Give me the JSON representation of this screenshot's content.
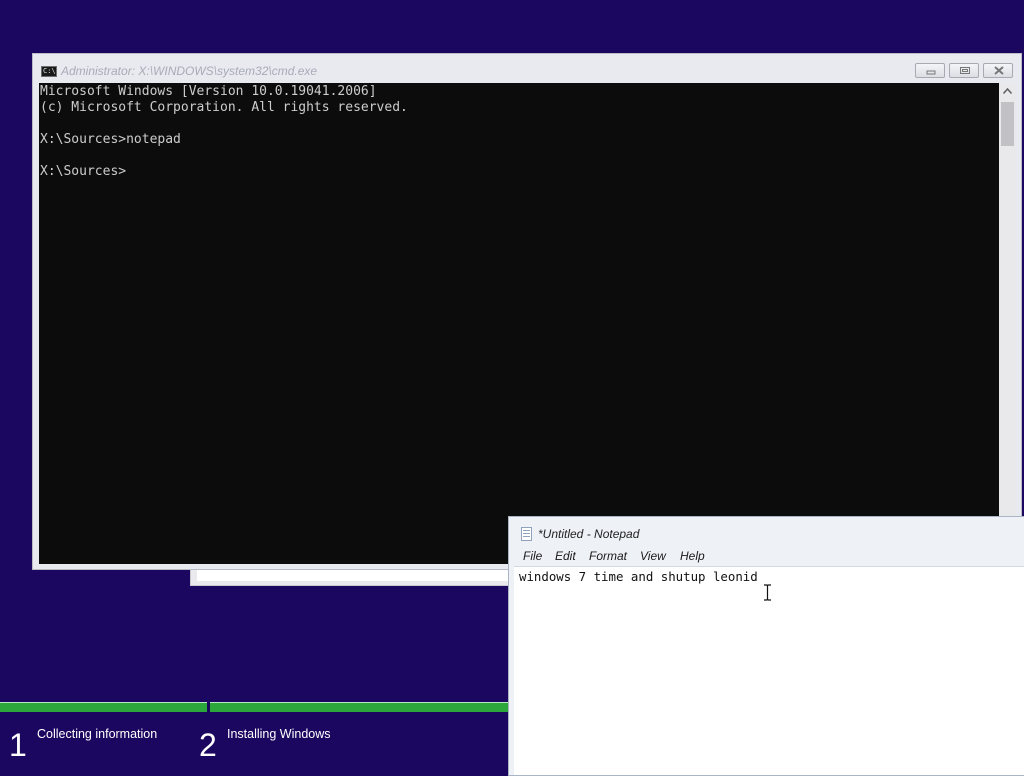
{
  "cmd_window": {
    "title": "Administrator: X:\\WINDOWS\\system32\\cmd.exe",
    "icon_text": "C:\\.",
    "console_lines": [
      "Microsoft Windows [Version 10.0.19041.2006]",
      "(c) Microsoft Corporation. All rights reserved.",
      "",
      "X:\\Sources>notepad",
      "",
      "X:\\Sources>"
    ]
  },
  "notepad_window": {
    "title": "*Untitled - Notepad",
    "menu": {
      "file": "File",
      "edit": "Edit",
      "format": "Format",
      "view": "View",
      "help": "Help"
    },
    "content": "windows 7 time and shutup leonid"
  },
  "setup_progress": {
    "steps": [
      {
        "number": "1",
        "label": "Collecting information"
      },
      {
        "number": "2",
        "label": "Installing Windows"
      }
    ],
    "colors": {
      "background": "#1c0760",
      "progress": "#2ba73c"
    }
  },
  "icons": [
    "cmd-icon",
    "minimize-icon",
    "maximize-icon",
    "close-icon",
    "scroll-up-icon",
    "notepad-icon",
    "text-cursor-icon"
  ]
}
